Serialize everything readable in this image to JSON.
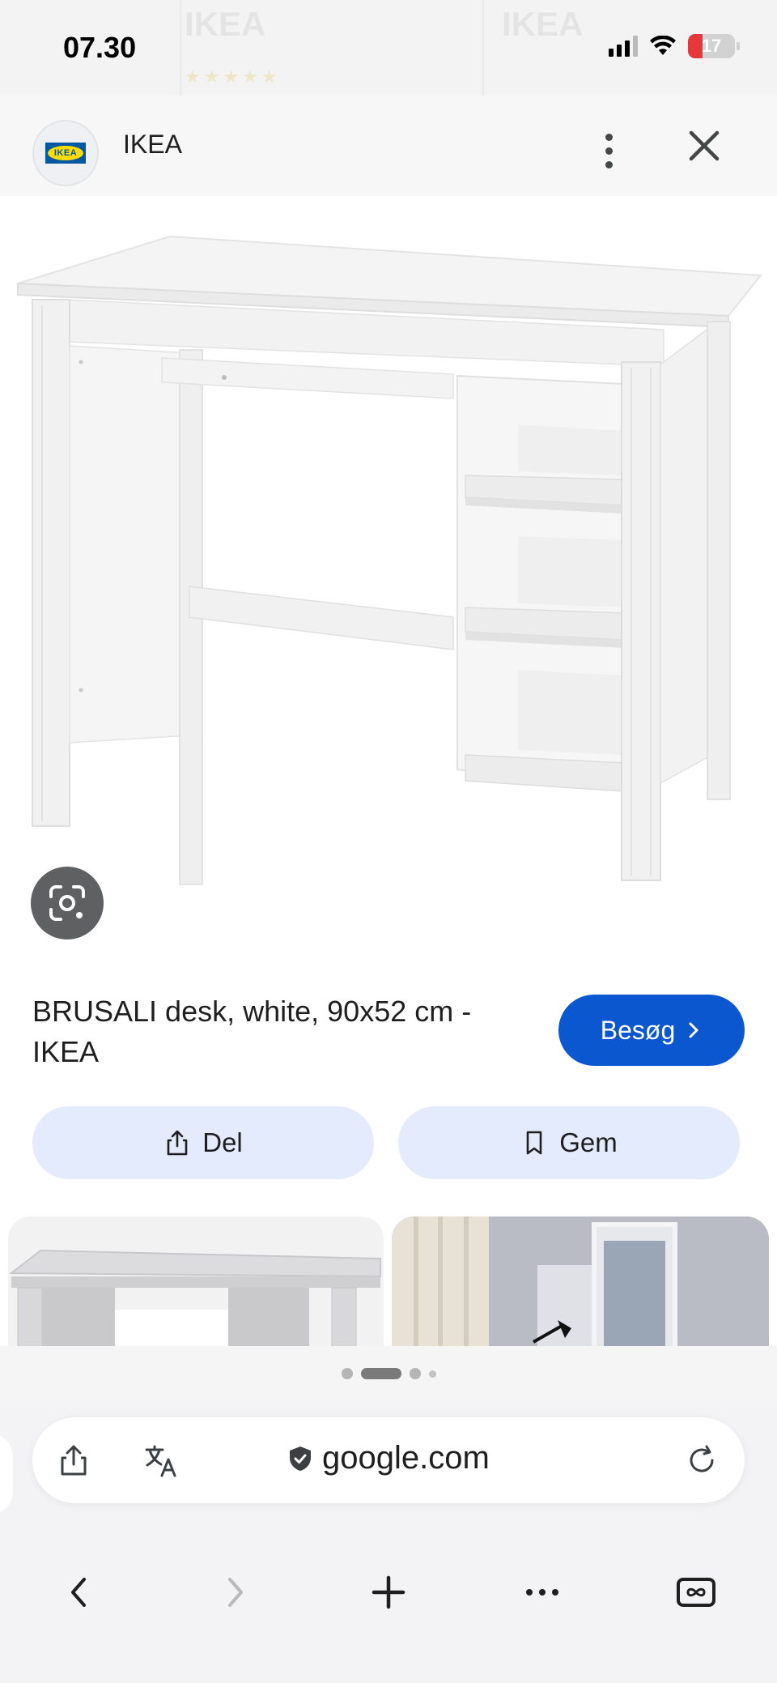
{
  "status_bar": {
    "time": "07.30",
    "battery_level": "17",
    "behind_page_ghost_text": [
      "IKEA",
      "IKEA"
    ]
  },
  "header": {
    "site_name": "IKEA",
    "logo_text": "IKEA",
    "icons": {
      "menu": "more-vert-icon",
      "close": "close-icon"
    }
  },
  "product": {
    "title": "BRUSALI desk, white, 90x52 cm - IKEA",
    "visit_label": "Besøg",
    "image_description_icon": "desk-image"
  },
  "actions": {
    "share_label": "Del",
    "save_label": "Gem"
  },
  "pager": {
    "count": 4,
    "active_index": 1
  },
  "browser": {
    "url": "google.com",
    "icons": {
      "share": "share-icon",
      "translate": "translate-icon",
      "secure": "shield-check-icon",
      "reload": "reload-icon",
      "back": "chevron-left-icon",
      "forward": "chevron-right-icon",
      "new_tab": "plus-icon",
      "more": "more-horiz-icon",
      "tabs": "tabs-icon"
    }
  },
  "colors": {
    "accent": "#0b57d0",
    "pill_bg": "#e3ebfd",
    "battery_low": "#e5383b"
  }
}
